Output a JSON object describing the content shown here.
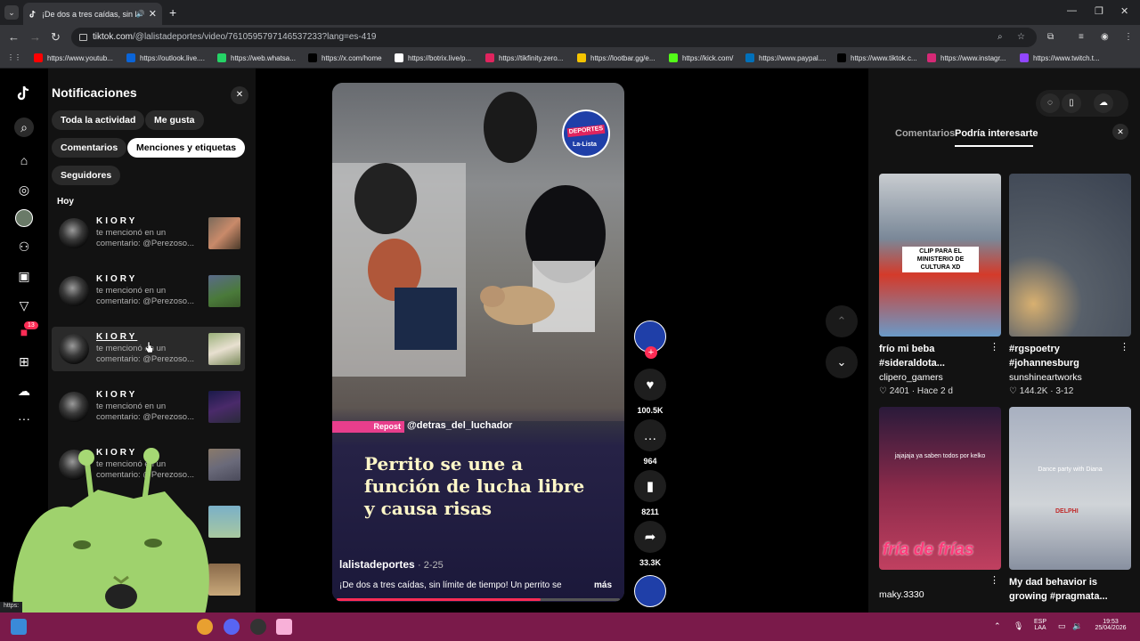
{
  "browser": {
    "tab_title": "¡De dos a tres caídas, sin lí",
    "url_host": "tiktok.com",
    "url_path": "/@lalistadeportes/video/7610595797146537233?lang=es-419",
    "bookmarks": [
      {
        "label": "https://www.youtub...",
        "color": "#ff0000"
      },
      {
        "label": "https://outlook.live....",
        "color": "#0a64d8"
      },
      {
        "label": "https://web.whatsa...",
        "color": "#25d366"
      },
      {
        "label": "https://x.com/home",
        "color": "#000000"
      },
      {
        "label": "https://botrix.live/p...",
        "color": "#ffffff"
      },
      {
        "label": "https://tikfinity.zero...",
        "color": "#e0245e"
      },
      {
        "label": "https://lootbar.gg/e...",
        "color": "#f5c400"
      },
      {
        "label": "https://kick.com/",
        "color": "#53fc18"
      },
      {
        "label": "https://www.paypal....",
        "color": "#0070ba"
      },
      {
        "label": "https://www.tiktok.c...",
        "color": "#000000"
      },
      {
        "label": "https://www.instagr...",
        "color": "#d62976"
      },
      {
        "label": "https://www.twitch.t...",
        "color": "#9146ff"
      }
    ]
  },
  "notifications": {
    "title": "Notificaciones",
    "filters": [
      {
        "label": "Toda la actividad",
        "active": false
      },
      {
        "label": "Me gusta",
        "active": false
      },
      {
        "label": "Comentarios",
        "active": false
      },
      {
        "label": "Menciones y etiquetas",
        "active": true
      },
      {
        "label": "Seguidores",
        "active": false
      }
    ],
    "section": "Hoy",
    "items": [
      {
        "user": "KIORY",
        "line1": "te mencionó en un",
        "line2": "comentario: @Perezoso..."
      },
      {
        "user": "KIORY",
        "line1": "te mencionó en un",
        "line2": "comentario: @Perezoso..."
      },
      {
        "user": "KIORY",
        "line1": "te mencionó en un",
        "line2": "comentario: @Perezoso..."
      },
      {
        "user": "KIORY",
        "line1": "te mencionó en un",
        "line2": "comentario: @Perezoso..."
      },
      {
        "user": "KIORY",
        "line1": "te mencionó en un",
        "line2": "comentario: @Perezoso..."
      }
    ],
    "nav_badge": "13"
  },
  "video": {
    "repost_label": "Repost",
    "repost_user": "@detras_del_luchador",
    "headline": [
      "Perrito se une a",
      "función de lucha libre",
      "y causa risas"
    ],
    "author": "lalistadeportes",
    "date": "2-25",
    "caption": "¡De dos a tres caídas, sin límite de tiempo! Un perrito se",
    "more": "más",
    "logo_top": "DEPORTES",
    "logo_bottom": "La-Lista",
    "progress": 0.72
  },
  "actions": {
    "likes": "100.5K",
    "comments": "964",
    "saves": "8211",
    "shares": "33.3K"
  },
  "right_panel": {
    "tab_comments": "Comentarios",
    "tab_suggested": "Podría interesarte",
    "cards": [
      {
        "title": "frío mi beba #sideraldota...",
        "user": "clipero_gamers",
        "meta": "♡ 2401 · Hace 2 d",
        "overlay": "CLIP PARA EL MINISTERIO DE CULTURA XD"
      },
      {
        "title": "#rgspoetry #johannesburg",
        "user": "sunshineartworks",
        "meta": "♡ 144.2K · 3-12",
        "overlay": ""
      },
      {
        "title": "",
        "user": "maky.3330",
        "meta": "",
        "overlay": "jajajaja ya saben todos por kelko",
        "big": "fría de frías"
      },
      {
        "title": "My dad behavior is growing #pragmata...",
        "user": "",
        "meta": "",
        "overlay": "Dance party with Diana",
        "brand": "DELPHI"
      }
    ]
  },
  "taskbar": {
    "lang1": "ESP",
    "lang2": "LAA",
    "time": "19:53",
    "date": "25/04/2026"
  },
  "status_url": "https:"
}
